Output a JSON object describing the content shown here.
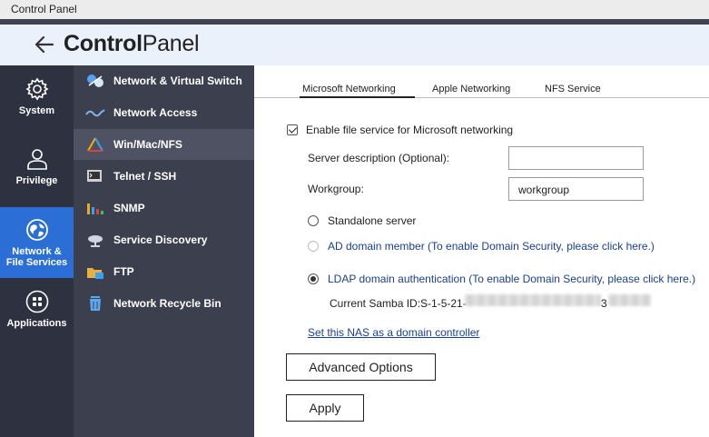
{
  "window": {
    "title": "Control Panel"
  },
  "header": {
    "title_bold": "Control",
    "title_light": "Panel"
  },
  "leftbar": {
    "items": [
      {
        "label": "System",
        "icon": "gear-icon"
      },
      {
        "label": "Privilege",
        "icon": "user-icon"
      },
      {
        "label_line1": "Network &",
        "label_line2": "File Services",
        "icon": "globe-icon",
        "active": true
      },
      {
        "label": "Applications",
        "icon": "apps-grid-icon"
      }
    ]
  },
  "midbar": {
    "items": [
      {
        "label": "Network & Virtual Switch",
        "icon": "network-switch-icon"
      },
      {
        "label": "Network Access",
        "icon": "network-access-icon"
      },
      {
        "label": "Win/Mac/NFS",
        "icon": "win-mac-nfs-icon",
        "active": true
      },
      {
        "label": "Telnet / SSH",
        "icon": "terminal-icon"
      },
      {
        "label": "SNMP",
        "icon": "bar-chart-icon"
      },
      {
        "label": "Service Discovery",
        "icon": "satellite-dish-icon"
      },
      {
        "label": "FTP",
        "icon": "ftp-folder-icon"
      },
      {
        "label": "Network Recycle Bin",
        "icon": "recycle-bin-icon"
      }
    ]
  },
  "tabs": [
    {
      "label": "Microsoft Networking",
      "active": true
    },
    {
      "label": "Apple Networking"
    },
    {
      "label": "NFS Service"
    }
  ],
  "form": {
    "enable_label": "Enable file service for Microsoft networking",
    "enable_checked": true,
    "server_desc_label": "Server description (Optional):",
    "server_desc_value": "",
    "workgroup_label": "Workgroup:",
    "workgroup_value": "workgroup",
    "standalone_label": "Standalone server",
    "ad_label": "AD domain member (To enable Domain Security, please click here.)",
    "ldap_label": "LDAP domain authentication (To enable Domain Security, please click here.)",
    "samba_prefix": "Current Samba ID:S-1-5-21-",
    "samba_mid": "3",
    "domain_controller_link": "Set this NAS as a domain controller",
    "advanced_button": "Advanced Options",
    "apply_button": "Apply"
  },
  "colors": {
    "leftbar_bg": "#2e3140",
    "leftbar_active": "#2b6fd6",
    "midbar_bg": "#3c3f4d",
    "midbar_active": "#4e5262",
    "header_bg": "#eaf1fb",
    "link": "#1a3f8f"
  }
}
